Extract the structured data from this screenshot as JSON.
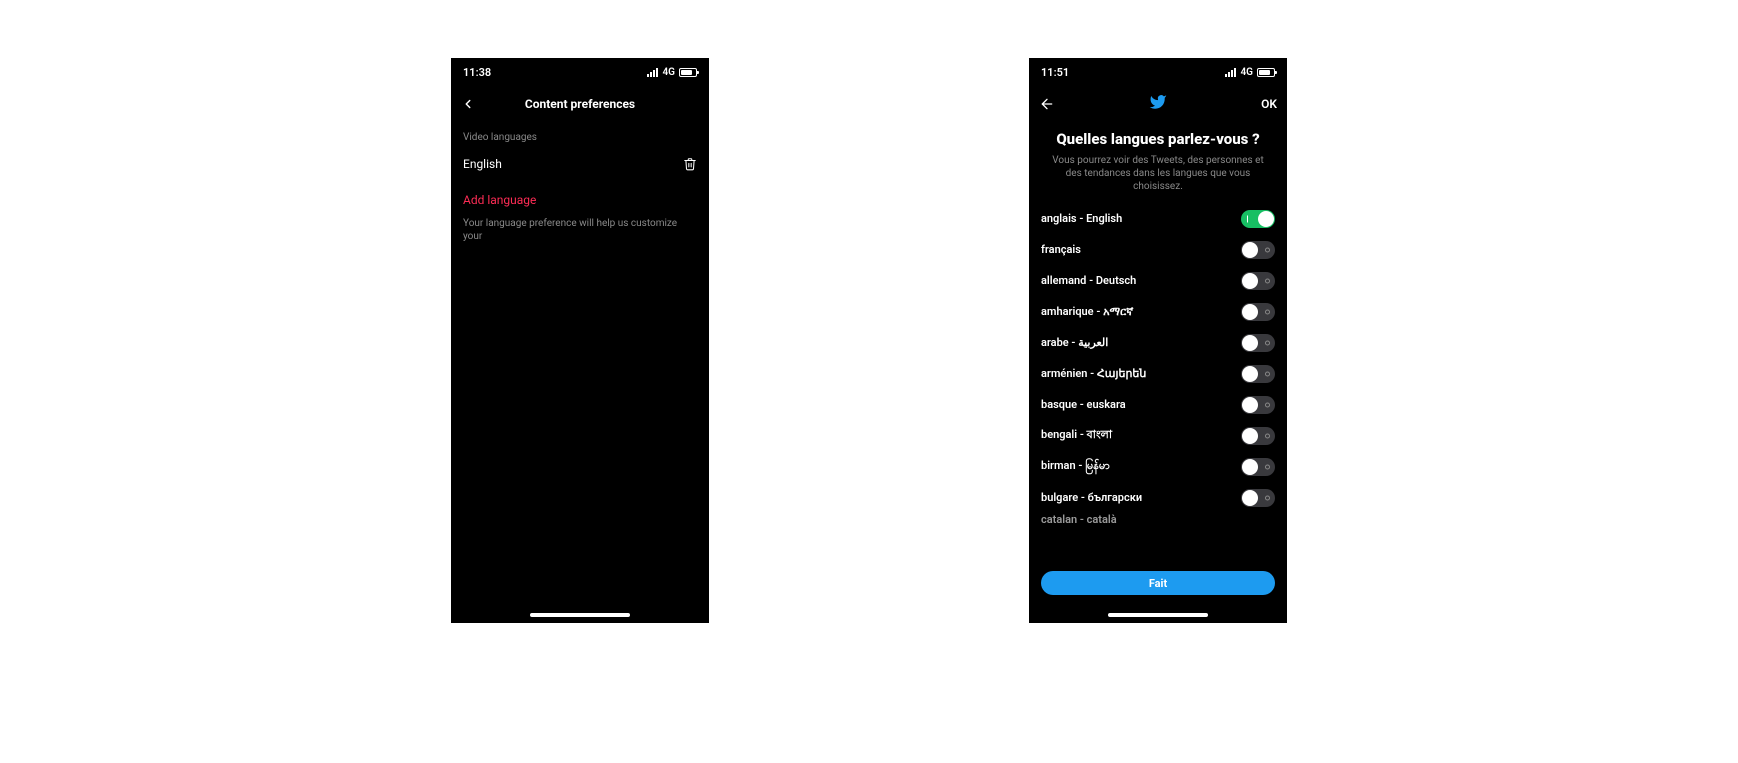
{
  "left": {
    "status": {
      "time": "11:38",
      "network": "4G"
    },
    "title": "Content preferences",
    "section_label": "Video languages",
    "item_label": "English",
    "add_label": "Add language",
    "helper": "Your language preference will help us customize your"
  },
  "right": {
    "status": {
      "time": "11:51",
      "network": "4G"
    },
    "ok_label": "OK",
    "heading": "Quelles langues parlez-vous ?",
    "subheading": "Vous pourrez voir des Tweets, des personnes et des tendances dans les langues que vous choisissez.",
    "languages": [
      {
        "label": "anglais - English",
        "on": true
      },
      {
        "label": "français",
        "on": false
      },
      {
        "label": "allemand - Deutsch",
        "on": false
      },
      {
        "label": "amharique - አማርኛ",
        "on": false
      },
      {
        "label": "arabe - العربية",
        "on": false
      },
      {
        "label": "arménien - Հայերեն",
        "on": false
      },
      {
        "label": "basque - euskara",
        "on": false
      },
      {
        "label": "bengali - বাংলা",
        "on": false
      },
      {
        "label": "birman - မြန်မာ",
        "on": false
      },
      {
        "label": "bulgare - български",
        "on": false
      }
    ],
    "partial_label": "catalan - català",
    "done_label": "Fait"
  }
}
